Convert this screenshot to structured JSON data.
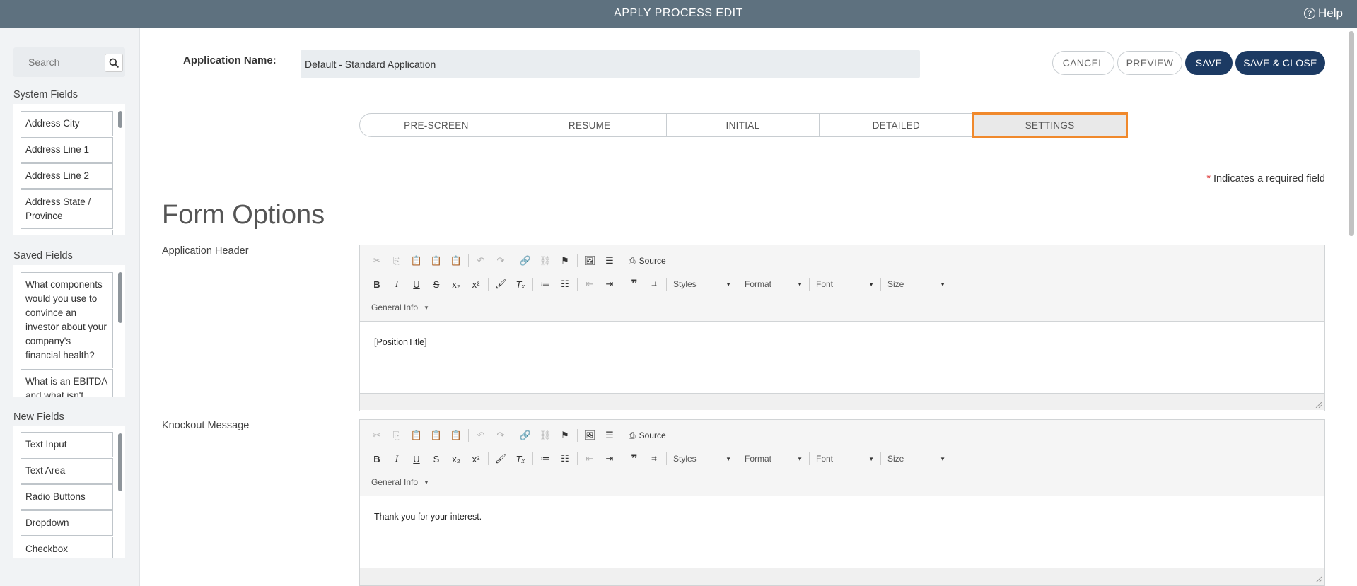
{
  "topbar": {
    "title": "APPLY PROCESS EDIT",
    "help_label": "Help"
  },
  "sidebar": {
    "search_placeholder": "Search",
    "system_fields": {
      "title": "System Fields",
      "items": [
        "Address City",
        "Address Line 1",
        "Address Line 2",
        "Address State / Province"
      ]
    },
    "saved_fields": {
      "title": "Saved Fields",
      "items": [
        "What components would you use to convince an investor about your company's financial health?",
        "What is an EBITDA and what isn't"
      ]
    },
    "new_fields": {
      "title": "New Fields",
      "items": [
        "Text Input",
        "Text Area",
        "Radio Buttons",
        "Dropdown",
        "Checkbox"
      ]
    }
  },
  "header": {
    "app_name_label": "Application Name:",
    "app_name_value": "Default - Standard Application",
    "cancel_label": "CANCEL",
    "preview_label": "PREVIEW",
    "save_label": "SAVE",
    "save_close_label": "SAVE & CLOSE"
  },
  "tabs": [
    {
      "label": "PRE-SCREEN",
      "active": false
    },
    {
      "label": "RESUME",
      "active": false
    },
    {
      "label": "INITIAL",
      "active": false
    },
    {
      "label": "DETAILED",
      "active": false
    },
    {
      "label": "SETTINGS",
      "active": true
    }
  ],
  "required_note": {
    "star": "*",
    "text": "Indicates a required field"
  },
  "form_title": "Form Options",
  "editor_toolbar": {
    "source_label": "Source",
    "styles_label": "Styles",
    "format_label": "Format",
    "font_label": "Font",
    "size_label": "Size",
    "general_info_label": "General Info"
  },
  "editors": [
    {
      "label": "Application Header",
      "content": "[PositionTitle]"
    },
    {
      "label": "Knockout Message",
      "content": "Thank you for your interest."
    }
  ],
  "colors": {
    "topbar": "#5e717f",
    "primary_button": "#1c3a63",
    "active_tab_outline": "#f0892c",
    "required_star": "#dd3333"
  }
}
